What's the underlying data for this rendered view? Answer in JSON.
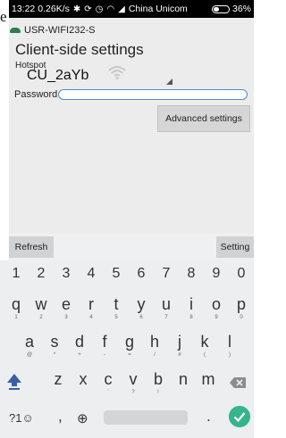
{
  "stray_text": "e",
  "status_bar": {
    "time": "13:22",
    "speed": "0.26K/s",
    "icons": [
      "bluetooth-icon",
      "sync-icon",
      "alarm-icon",
      "wifi-icon",
      "signal-icon"
    ],
    "carrier": "China Unicom",
    "battery": "36%"
  },
  "app": {
    "title": "USR-WIFI232-S",
    "heading": "Client-side settings",
    "hotspot_label": "Hotspot",
    "hotspot_value": "CU_2aYb",
    "password_label": "Password",
    "password_value": "",
    "advanced_button": "Advanced settings"
  },
  "keyboard": {
    "refresh_label": "Refresh",
    "setting_label": "Setting",
    "numbers": [
      "1",
      "2",
      "3",
      "4",
      "5",
      "6",
      "7",
      "8",
      "9",
      "0"
    ],
    "row1": [
      {
        "k": "q",
        "s": "1"
      },
      {
        "k": "w",
        "s": "2"
      },
      {
        "k": "e",
        "s": "3"
      },
      {
        "k": "r",
        "s": "4"
      },
      {
        "k": "t",
        "s": "5"
      },
      {
        "k": "y",
        "s": "6"
      },
      {
        "k": "u",
        "s": "7"
      },
      {
        "k": "i",
        "s": "8"
      },
      {
        "k": "o",
        "s": "9"
      },
      {
        "k": "p",
        "s": "0"
      }
    ],
    "row2": [
      {
        "k": "a",
        "s": "@"
      },
      {
        "k": "s",
        "s": "*"
      },
      {
        "k": "d",
        "s": "+"
      },
      {
        "k": "f",
        "s": "-"
      },
      {
        "k": "g",
        "s": "="
      },
      {
        "k": "h",
        "s": "/"
      },
      {
        "k": "j",
        "s": "#"
      },
      {
        "k": "k",
        "s": "("
      },
      {
        "k": "l",
        "s": ")"
      }
    ],
    "row3": [
      {
        "k": "z",
        "s": ""
      },
      {
        "k": "x",
        "s": ""
      },
      {
        "k": "c",
        "s": "'"
      },
      {
        "k": "v",
        "s": "?"
      },
      {
        "k": "b",
        "s": "!"
      },
      {
        "k": "n",
        "s": ""
      },
      {
        "k": "m",
        "s": ""
      }
    ],
    "sym_label": "?1☺",
    "comma": ",",
    "period": "."
  },
  "colors": {
    "accent": "#4a8fd4",
    "enter_key": "#36b58c",
    "app_background": "#ececec",
    "status_bar": "#000000"
  }
}
